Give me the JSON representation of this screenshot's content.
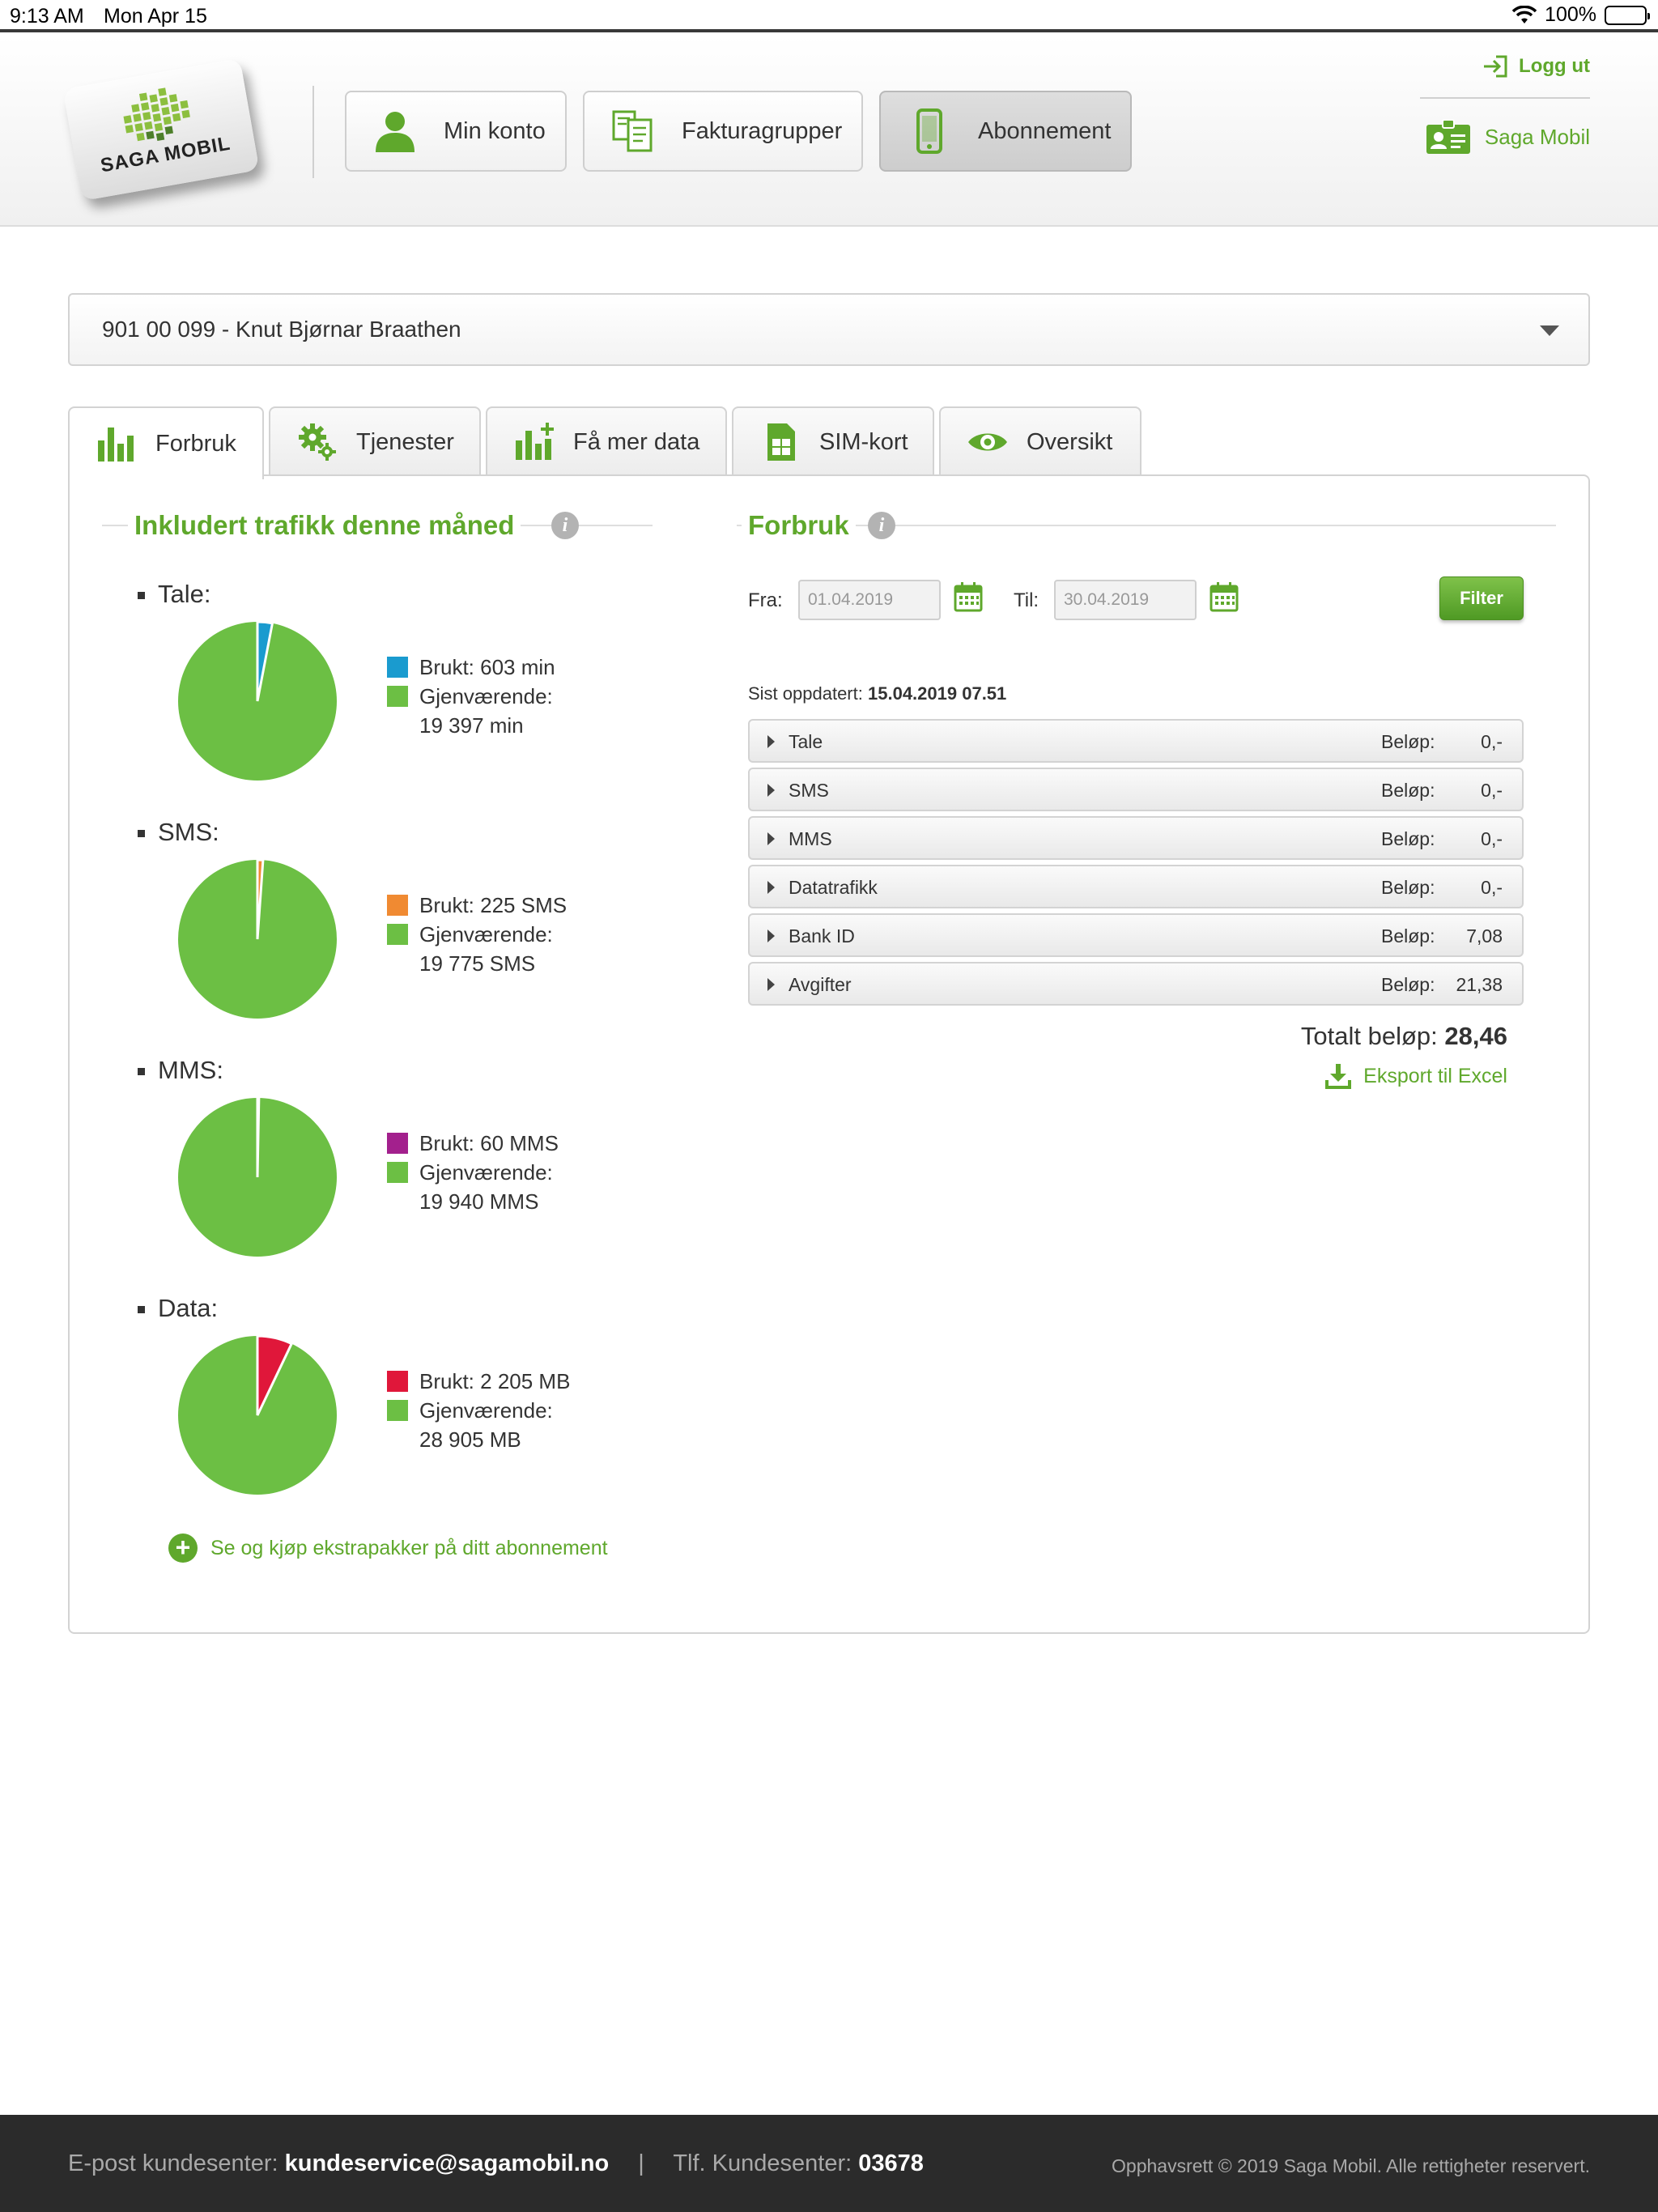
{
  "status_bar": {
    "time": "9:13 AM",
    "date": "Mon Apr 15",
    "battery": "100%"
  },
  "header": {
    "logo_text": "SAGA MOBIL",
    "nav": [
      {
        "label": "Min konto",
        "icon": "person-icon"
      },
      {
        "label": "Fakturagrupper",
        "icon": "documents-icon"
      },
      {
        "label": "Abonnement",
        "icon": "phone-icon",
        "active": true
      }
    ],
    "logout_label": "Logg ut",
    "account_label": "Saga Mobil"
  },
  "subscription": {
    "selected": "901 00 099 - Knut Bjørnar Braathen"
  },
  "tabs": [
    {
      "label": "Forbruk",
      "icon": "bar-chart-icon",
      "active": true
    },
    {
      "label": "Tjenester",
      "icon": "gears-icon"
    },
    {
      "label": "Få mer data",
      "icon": "bar-chart-plus-icon"
    },
    {
      "label": "SIM-kort",
      "icon": "sim-card-icon"
    },
    {
      "label": "Oversikt",
      "icon": "eye-icon"
    }
  ],
  "included": {
    "title": "Inkludert trafikk denne måned",
    "items": [
      {
        "label": "Tale:",
        "used_text": "Brukt: 603 min",
        "remaining_label": "Gjenværende:",
        "remaining_text": "19 397 min",
        "used": 603,
        "remaining": 19397,
        "used_color": "#1a9bcf"
      },
      {
        "label": "SMS:",
        "used_text": "Brukt: 225 SMS",
        "remaining_label": "Gjenværende:",
        "remaining_text": "19 775 SMS",
        "used": 225,
        "remaining": 19775,
        "used_color": "#f08a32"
      },
      {
        "label": "MMS:",
        "used_text": "Brukt: 60 MMS",
        "remaining_label": "Gjenværende:",
        "remaining_text": "19 940 MMS",
        "used": 60,
        "remaining": 19940,
        "used_color": "#a3208d"
      },
      {
        "label": "Data:",
        "used_text": "Brukt: 2 205 MB",
        "remaining_label": "Gjenværende:",
        "remaining_text": "28 905 MB",
        "used": 2205,
        "remaining": 28905,
        "used_color": "#e0173a"
      }
    ],
    "remaining_color": "#6cbf44",
    "extra_link": "Se og kjøp ekstrapakker på ditt abonnement"
  },
  "usage": {
    "title": "Forbruk",
    "from_label": "Fra:",
    "from_value": "01.04.2019",
    "to_label": "Til:",
    "to_value": "30.04.2019",
    "filter_label": "Filter",
    "last_updated_label": "Sist oppdatert:",
    "last_updated_value": "15.04.2019 07.51",
    "rows": [
      {
        "name": "Tale",
        "amount_label": "Beløp:",
        "amount": "0,-"
      },
      {
        "name": "SMS",
        "amount_label": "Beløp:",
        "amount": "0,-"
      },
      {
        "name": "MMS",
        "amount_label": "Beløp:",
        "amount": "0,-"
      },
      {
        "name": "Datatrafikk",
        "amount_label": "Beløp:",
        "amount": "0,-"
      },
      {
        "name": "Bank ID",
        "amount_label": "Beløp:",
        "amount": "7,08"
      },
      {
        "name": "Avgifter",
        "amount_label": "Beløp:",
        "amount": "21,38"
      }
    ],
    "total_label": "Totalt beløp:",
    "total_value": "28,46",
    "export_label": "Eksport til Excel"
  },
  "footer": {
    "email_label": "E-post kundesenter:",
    "email": "kundeservice@sagamobil.no",
    "separator": "|",
    "phone_label": "Tlf. Kundesenter:",
    "phone": "03678",
    "copyright": "Opphavsrett © 2019 Saga Mobil. Alle rettigheter reservert."
  },
  "colors": {
    "brand_green": "#5fa82c",
    "footer_bg": "#2b2b2b"
  }
}
